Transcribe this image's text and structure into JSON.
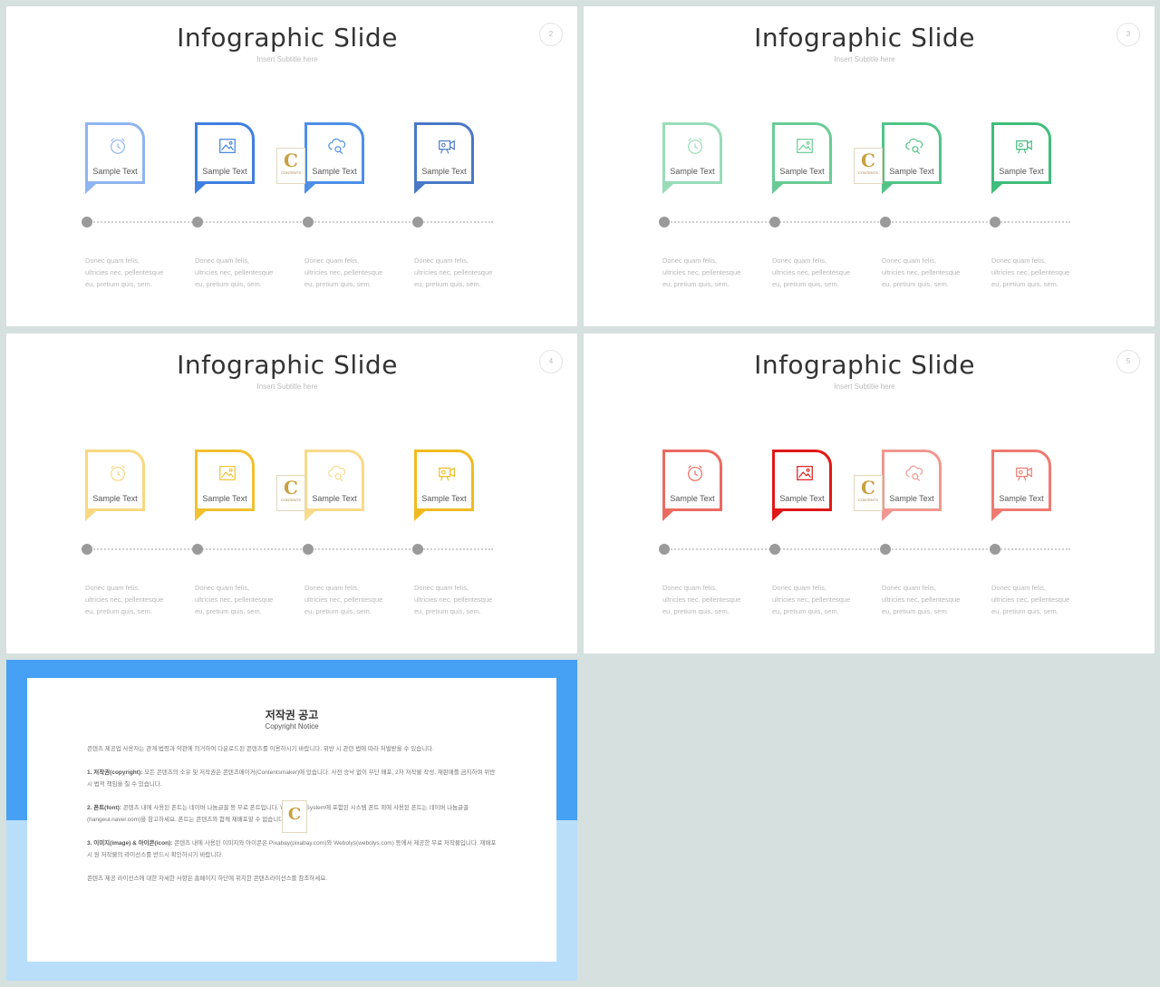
{
  "slides": [
    {
      "title": "Infographic Slide",
      "subtitle": "Insert Subtitle here",
      "page": "2",
      "colors": [
        "#8fb4f0",
        "#3f7fe0",
        "#4d8fe8",
        "#4a78c6"
      ]
    },
    {
      "title": "Infographic Slide",
      "subtitle": "Insert Subtitle here",
      "page": "3",
      "colors": [
        "#98dcb8",
        "#6acb95",
        "#52c488",
        "#3fbd7b"
      ]
    },
    {
      "title": "Infographic Slide",
      "subtitle": "Insert Subtitle here",
      "page": "4",
      "colors": [
        "#f8d880",
        "#f2c030",
        "#f8da8a",
        "#f0bb20"
      ]
    },
    {
      "title": "Infographic Slide",
      "subtitle": "Insert Subtitle here",
      "page": "5",
      "colors": [
        "#ec6a60",
        "#e01818",
        "#f09890",
        "#ee7a70"
      ]
    }
  ],
  "card_label": "Sample  Text",
  "card_icons": [
    "alarm-clock-icon",
    "image-icon",
    "cloud-search-icon",
    "video-camera-icon"
  ],
  "desc_lines": [
    "Donec  quam  felis,",
    "ultricies  nec,  pellentesque",
    "eu,  pretium  quis,  sem."
  ],
  "logo": {
    "letter": "C",
    "text": "CONTENTS"
  },
  "copyright": {
    "title": "저작권 공고",
    "subtitle": "Copyright Notice",
    "intro": "콘텐츠 제공업 사용자는 관계 법령과 약관에 의거하여 다운로드된 콘텐츠를 이용하시기 바랍니다. 위반 시 관련 법에 따라 처벌받을 수 있습니다.",
    "p1_head": "1. 저작권(copyright):",
    "p1": "모든 콘텐츠의 소유 및 저작권은 콘텐츠메이커(Contentsmaker)에 있습니다. 사전 승낙 없이 무단 배포, 2차 저작물 작성, 재판매를 금지하며 위반 시 법적 책임을 질 수 있습니다.",
    "p2_head": "2. 폰트(font):",
    "p2": "콘텐츠 내에 사용된 폰트는 네이버 나눔글꼴 등 무료 폰트입니다. Windows System에 포함된 시스템 폰트 외에 사용된 폰트는 네이버 나눔글꼴(hangeul.naver.com)을 참고하세요. 폰트는 콘텐츠와 함께 재배포할 수 없습니다.",
    "p3_head": "3. 이미지(image) & 아이콘(icon):",
    "p3": "콘텐츠 내에 사용된 이미지와 아이콘은 Pixabay(pixabay.com)와 Webolys(webolys.com) 등에서 제공한 무료 저작물입니다. 재배포 시 원 저작물의 라이선스를 반드시 확인하시기 바랍니다.",
    "outro": "콘텐츠 제공 라이선스에 대한 자세한 사항은 홈페이지 하단에 위치한 콘텐츠라이선스를 참조하세요."
  }
}
